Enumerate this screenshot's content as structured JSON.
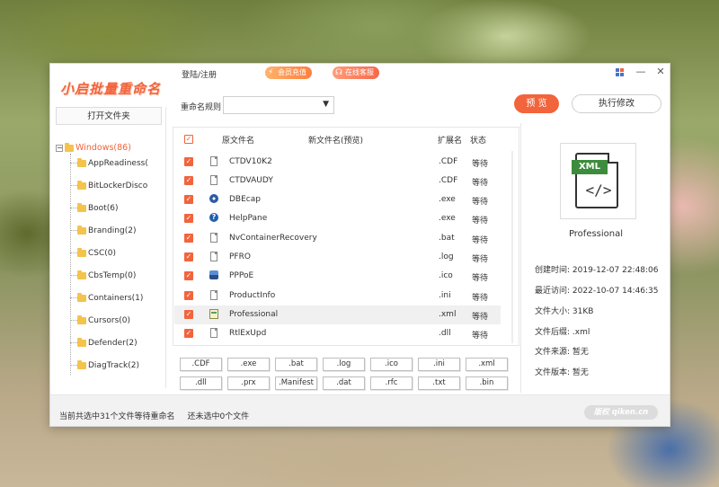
{
  "app": {
    "logo_text": "小启批量重命名",
    "login_link": "登陆/注册",
    "vip_badge": "会员充值",
    "service_badge": "在线客服",
    "minimize_glyph": "—",
    "close_glyph": "✕"
  },
  "left": {
    "open_folder": "打开文件夹",
    "tree_root": "Windows(86)",
    "tree_items": [
      "AppReadiness(",
      "BitLockerDisco",
      "Boot(6)",
      "Branding(2)",
      "CSC(0)",
      "CbsTemp(0)",
      "Containers(1)",
      "Cursors(0)",
      "Defender(2)",
      "DiagTrack(2)"
    ]
  },
  "toolbar": {
    "rule_label": "重命名规则",
    "rule_value": "",
    "preview_button": "预 览",
    "execute_button": "执行修改"
  },
  "table": {
    "columns": {
      "original": "原文件名",
      "new_name": "新文件名(预览)",
      "extension": "扩展名",
      "status": "状态"
    },
    "rows": [
      {
        "name": "CTDV10K2",
        "ext": ".CDF",
        "status": "等待",
        "icon": "document-icon"
      },
      {
        "name": "CTDVAUDY",
        "ext": ".CDF",
        "status": "等待",
        "icon": "document-icon"
      },
      {
        "name": "DBEcap",
        "ext": ".exe",
        "status": "等待",
        "icon": "gear-icon"
      },
      {
        "name": "HelpPane",
        "ext": ".exe",
        "status": "等待",
        "icon": "help-icon"
      },
      {
        "name": "NvContainerRecovery",
        "ext": ".bat",
        "status": "等待",
        "icon": "script-icon"
      },
      {
        "name": "PFRO",
        "ext": ".log",
        "status": "等待",
        "icon": "document-icon"
      },
      {
        "name": "PPPoE",
        "ext": ".ico",
        "status": "等待",
        "icon": "network-icon"
      },
      {
        "name": "ProductInfo",
        "ext": ".ini",
        "status": "等待",
        "icon": "document-icon"
      },
      {
        "name": "Professional",
        "ext": ".xml",
        "status": "等待",
        "icon": "xml-icon"
      },
      {
        "name": "RtlExUpd",
        "ext": ".dll",
        "status": "等待",
        "icon": "document-icon"
      }
    ],
    "selected_row": 8
  },
  "extensions": {
    "row1": [
      ".CDF",
      ".exe",
      ".bat",
      ".log",
      ".ico",
      ".ini",
      ".xml"
    ],
    "row2": [
      ".dll",
      ".prx",
      ".Manifest",
      ".dat",
      ".rfc",
      ".txt",
      ".bin"
    ]
  },
  "details": {
    "icon_label": "XML",
    "icon_symbol": "</>",
    "file_name": "Professional",
    "created_label": "创建时间:",
    "created": "2019-12-07 22:48:06",
    "accessed_label": "最近访问:",
    "accessed": "2022-10-07 14:46:35",
    "size_label": "文件大小:",
    "size": "31KB",
    "suffix_label": "文件后缀:",
    "suffix": ".xml",
    "source_label": "文件来源:",
    "source": "暂无",
    "version_label": "文件版本:",
    "version": "暂无"
  },
  "status": {
    "total": "当前共选中31个文件等待重命名",
    "unselected": "还未选中0个文件",
    "watermark": "版权 qiken.cn"
  },
  "colors": {
    "accent": "#f2643c",
    "folder": "#f3c34c",
    "xml_green": "#3d8c3d"
  }
}
